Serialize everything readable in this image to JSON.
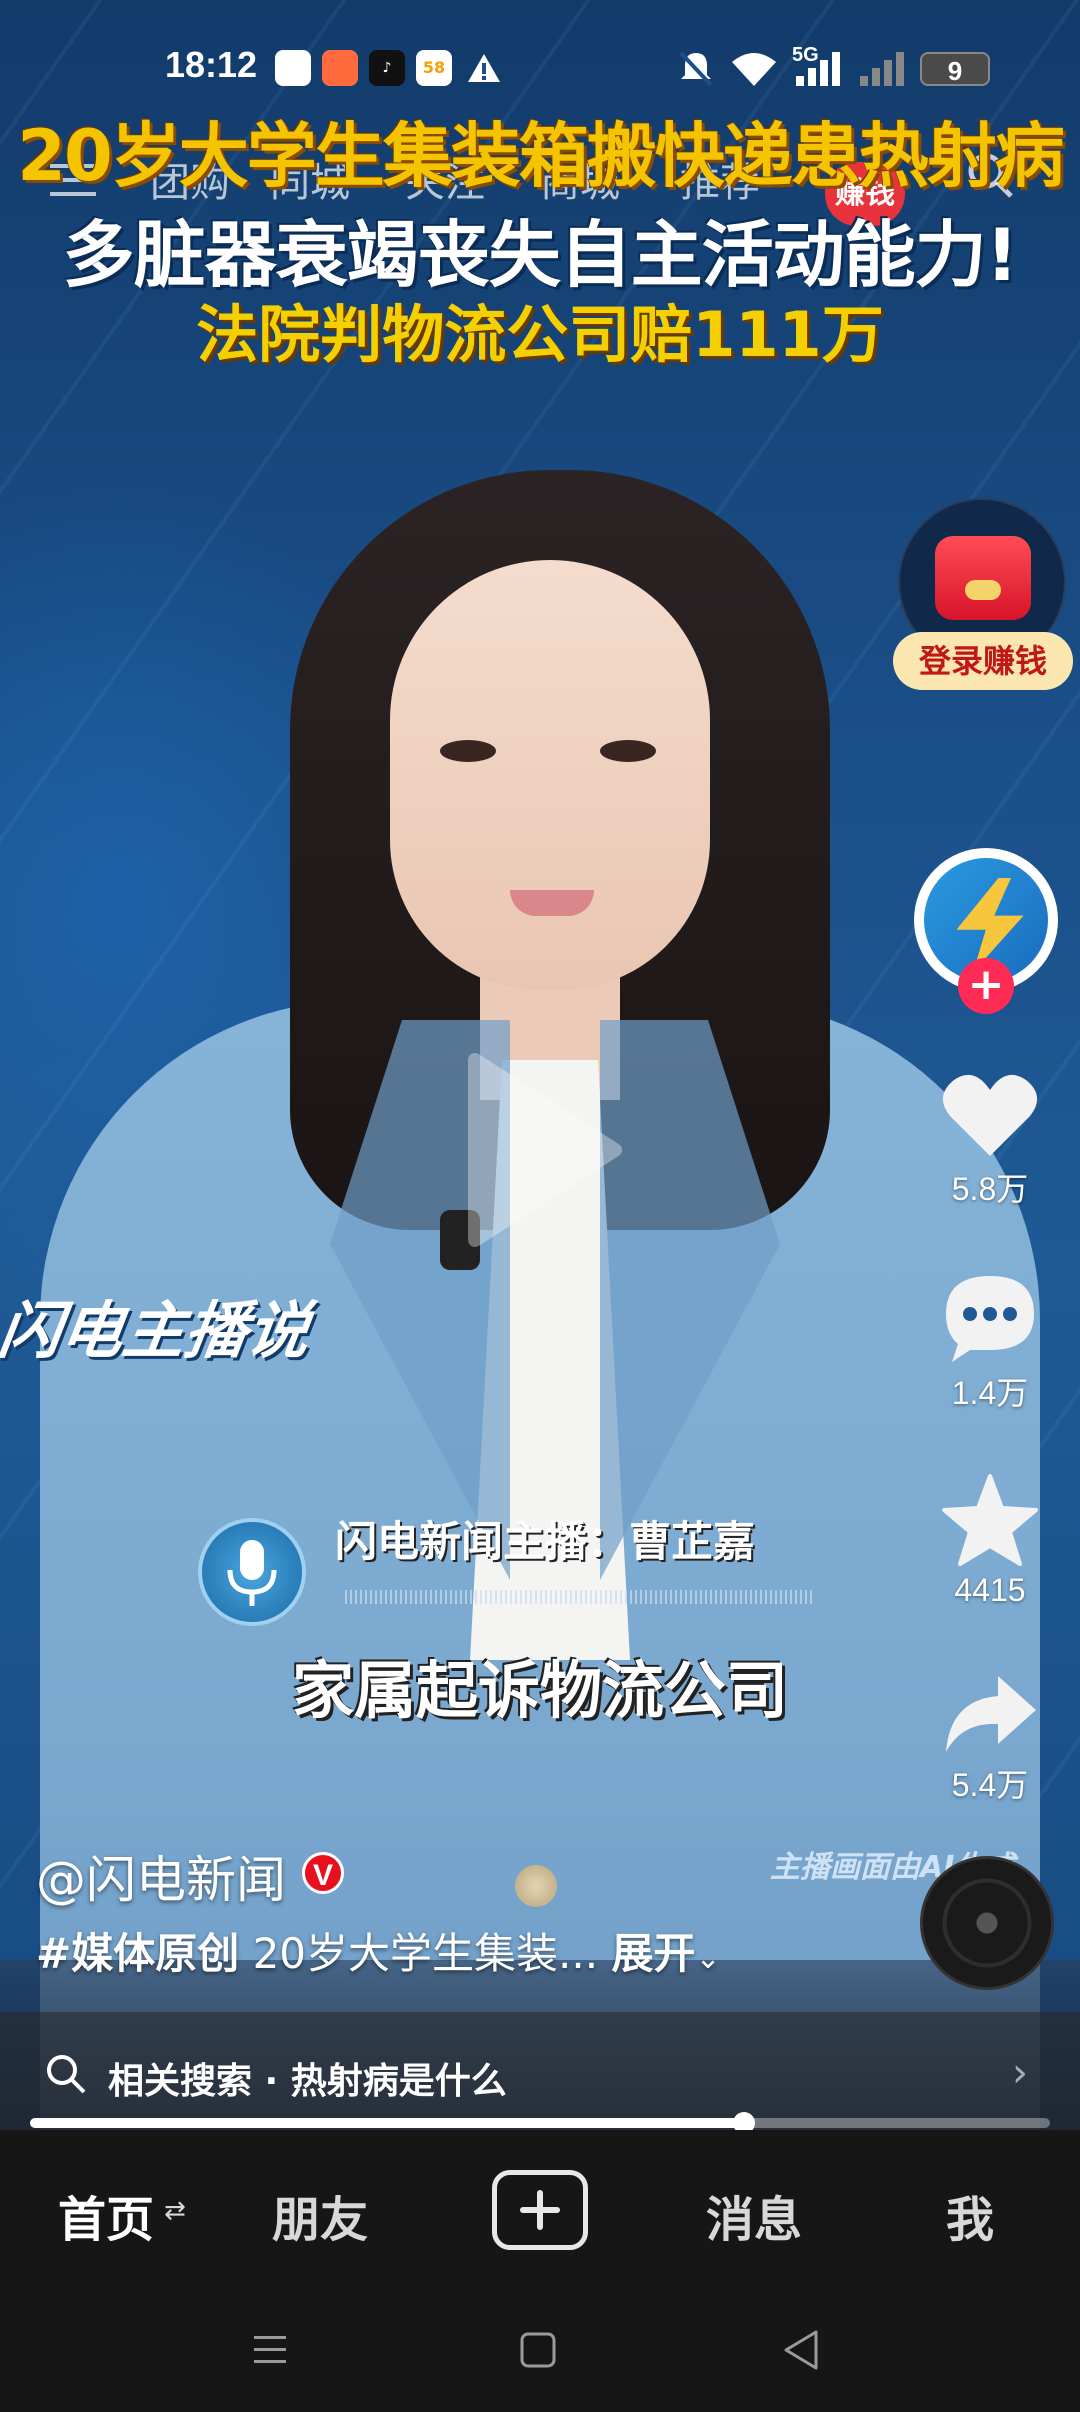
{
  "status_bar": {
    "time": "18:12",
    "app_icons": [
      "视频号",
      "游戏",
      "抖音",
      "58同城",
      "警告"
    ],
    "network": "5G",
    "battery": "9"
  },
  "top_nav": {
    "items": [
      "团购",
      "同城",
      "关注",
      "商城",
      "推荐"
    ],
    "earn_badge": "赚钱"
  },
  "headline": {
    "line1": "20岁大学生集装箱搬快递患热射病",
    "line2": "多脏器衰竭丧失自主活动能力!",
    "line3": "法院判物流公司赔111万"
  },
  "promo": {
    "label": "登录赚钱"
  },
  "actions": {
    "likes": "5.8万",
    "comments": "1.4万",
    "favorites": "4415",
    "shares": "5.4万"
  },
  "overlay": {
    "brand": "闪电主播说",
    "anchor_name": "闪电新闻主播：曹芷嘉",
    "subtitle": "家属起诉物流公司",
    "ai_note": "主播画面由AI生成"
  },
  "post": {
    "author": "@闪电新闻",
    "verified_mark": "V",
    "hashtag": "#媒体原创",
    "description": "20岁大学生集装...",
    "expand_label": "展开"
  },
  "related_search": {
    "text": "相关搜索 · 热射病是什么"
  },
  "progress": {
    "fraction": 0.7
  },
  "bottom_nav": {
    "tabs": [
      "首页",
      "朋友",
      "消息",
      "我"
    ]
  },
  "colors": {
    "headline_yellow": "#f4c400",
    "accent_red": "#fe2c55",
    "nav_bg": "#161616"
  }
}
